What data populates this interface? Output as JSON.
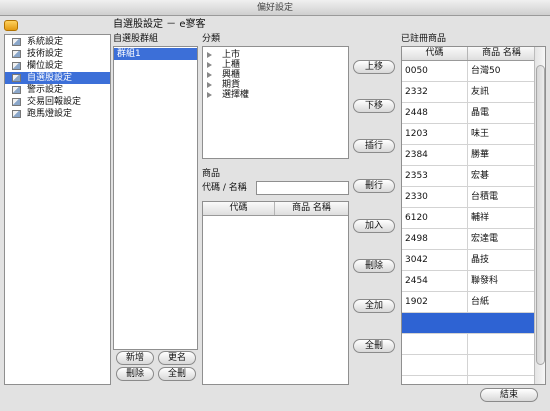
{
  "window": {
    "title": "偏好設定"
  },
  "page": {
    "heading": "自選股設定 － e寥客"
  },
  "sidebar": {
    "items": [
      {
        "label": "系統設定"
      },
      {
        "label": "技術設定"
      },
      {
        "label": "欄位設定"
      },
      {
        "label": "自選股設定",
        "selected": true
      },
      {
        "label": "警示設定"
      },
      {
        "label": "交易回報設定"
      },
      {
        "label": "跑馬燈設定"
      }
    ]
  },
  "groups": {
    "title": "自選股群組",
    "items": [
      {
        "label": "群組1",
        "selected": true
      }
    ],
    "buttons": {
      "add": "新增",
      "rename": "更名",
      "delete": "刪除",
      "delete_all": "全刪"
    }
  },
  "categories": {
    "title": "分類",
    "items": [
      {
        "label": "上市"
      },
      {
        "label": "上櫃"
      },
      {
        "label": "興櫃"
      },
      {
        "label": "期貨"
      },
      {
        "label": "選擇權"
      }
    ]
  },
  "products": {
    "title": "商品",
    "search_label": "代碼 / 名稱",
    "search_value": "",
    "columns": {
      "code": "代碼",
      "name": "商品 名稱"
    }
  },
  "actions": {
    "move_up": "上移",
    "move_down": "下移",
    "insert": "插行",
    "delete_row": "刪行",
    "add": "加入",
    "remove": "刪除",
    "add_all": "全加",
    "remove_all": "全刪"
  },
  "registered": {
    "title": "已註冊商品",
    "columns": {
      "code": "代碼",
      "name": "商品 名稱"
    },
    "rows": [
      {
        "code": "0050",
        "name": "台灣50"
      },
      {
        "code": "2332",
        "name": "友訊"
      },
      {
        "code": "2448",
        "name": "晶電"
      },
      {
        "code": "1203",
        "name": "味王"
      },
      {
        "code": "2384",
        "name": "勝華"
      },
      {
        "code": "2353",
        "name": "宏碁"
      },
      {
        "code": "2330",
        "name": "台積電"
      },
      {
        "code": "6120",
        "name": "輔祥"
      },
      {
        "code": "2498",
        "name": "宏達電"
      },
      {
        "code": "3042",
        "name": "晶技"
      },
      {
        "code": "2454",
        "name": "聯發科"
      },
      {
        "code": "1902",
        "name": "台紙"
      },
      {
        "code": "",
        "name": "",
        "selected": true
      },
      {
        "code": "",
        "name": ""
      },
      {
        "code": "",
        "name": ""
      },
      {
        "code": "",
        "name": ""
      }
    ]
  },
  "footer": {
    "done": "結束"
  }
}
